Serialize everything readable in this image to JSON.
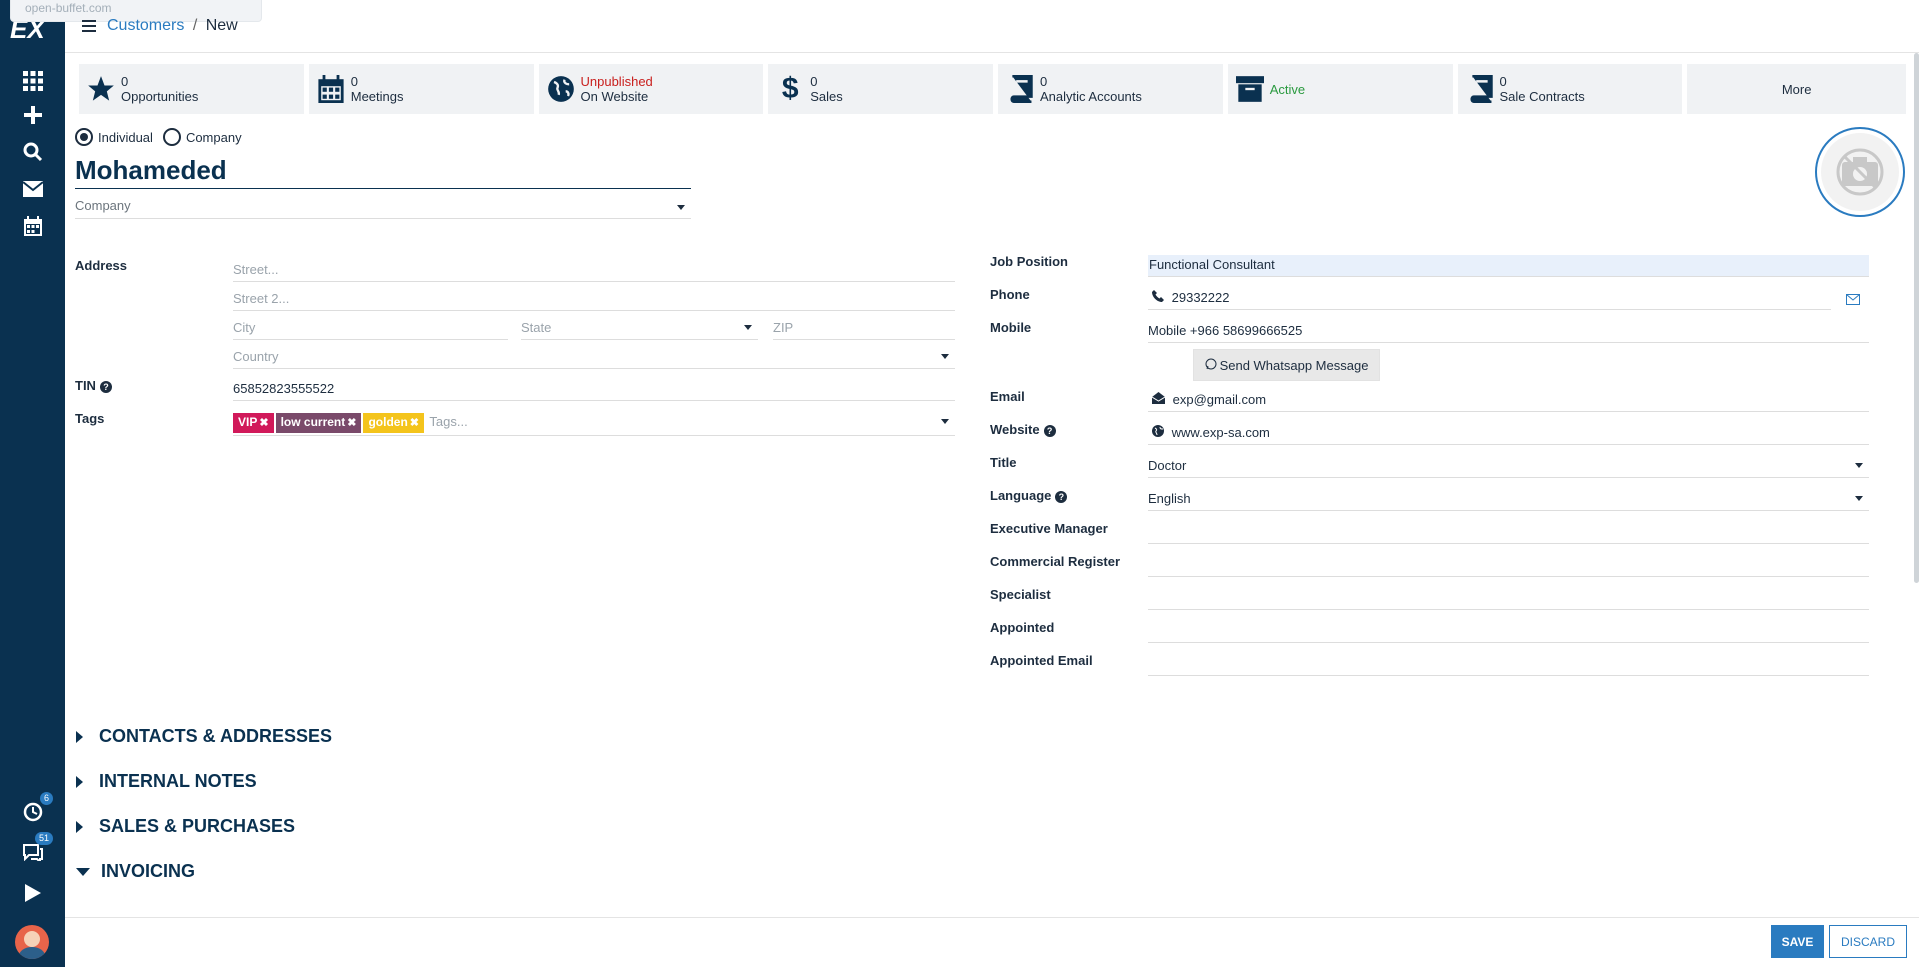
{
  "sidebar": {
    "logo": "EX",
    "tooltip": "open-buffet.com",
    "activity_badge": "6",
    "chat_badge": "51"
  },
  "breadcrumb": {
    "parent": "Customers",
    "separator": "/",
    "current": "New"
  },
  "stats": [
    {
      "icon": "star-icon",
      "value": "0",
      "label": "Opportunities"
    },
    {
      "icon": "calendar-icon",
      "value": "0",
      "label": "Meetings"
    },
    {
      "icon": "globe-icon",
      "value": "Unpublished",
      "label": "On Website"
    },
    {
      "icon": "dollar-icon",
      "value": "0",
      "label": "Sales"
    },
    {
      "icon": "book-icon",
      "value": "0",
      "label": "Analytic Accounts"
    },
    {
      "icon": "archive-icon",
      "value": "Active",
      "label": ""
    },
    {
      "icon": "book-icon",
      "value": "0",
      "label": "Sale Contracts"
    },
    {
      "icon": "",
      "value": "More",
      "label": ""
    }
  ],
  "type": {
    "individual": "Individual",
    "company": "Company",
    "selected": "Individual"
  },
  "name": "Mohameded",
  "company_placeholder": "Company",
  "left": {
    "address_label": "Address",
    "street_ph": "Street...",
    "street2_ph": "Street 2...",
    "city_ph": "City",
    "state_ph": "State",
    "zip_ph": "ZIP",
    "country_ph": "Country",
    "tin_label": "TIN",
    "tin_value": "65852823555522",
    "tags_label": "Tags",
    "tags": [
      {
        "label": "VIP",
        "color": "#d1195a"
      },
      {
        "label": "low current",
        "color": "#7a4a6a"
      },
      {
        "label": "golden",
        "color": "#f4c41c"
      }
    ],
    "tags_ph": "Tags..."
  },
  "right": {
    "job_label": "Job Position",
    "job_value": "Functional Consultant",
    "phone_label": "Phone",
    "phone_value": "29332222",
    "mobile_label": "Mobile",
    "mobile_prefix": "Mobile",
    "mobile_value": "+966 58699666525",
    "whatsapp_btn": "Send Whatsapp Message",
    "email_label": "Email",
    "email_value": "exp@gmail.com",
    "website_label": "Website",
    "website_value": "www.exp-sa.com",
    "title_label": "Title",
    "title_value": "Doctor",
    "language_label": "Language",
    "language_value": "English",
    "exec_label": "Executive Manager",
    "commercial_label": "Commercial Register",
    "specialist_label": "Specialist",
    "appointed_label": "Appointed",
    "appointed_email_label": "Appointed Email"
  },
  "sections": [
    "CONTACTS & ADDRESSES",
    "INTERNAL NOTES",
    "SALES & PURCHASES",
    "INVOICING"
  ],
  "footer": {
    "save": "SAVE",
    "discard": "DISCARD"
  }
}
